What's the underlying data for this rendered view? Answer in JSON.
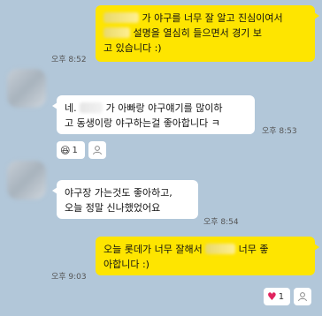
{
  "messages": [
    {
      "direction": "out",
      "lines": [
        [
          "",
          "가 야구를 너무 잘 알고 진심이여서"
        ],
        [
          "",
          "설명을 열심히 들으면서 경기 보"
        ],
        [
          "고 있습니다 :)"
        ]
      ],
      "time": "오후 8:52"
    },
    {
      "direction": "in",
      "lines": [
        [
          "네. ",
          "가 아빠랑 야구얘기를 많이하"
        ],
        [
          "고 동생이랑 야구하는걸 좋아합니다 ㅋ"
        ]
      ],
      "time": "오후 8:53",
      "reaction": {
        "emoji_icon": "laughing-face-icon",
        "emoji": "😆",
        "count": "1"
      }
    },
    {
      "direction": "in",
      "lines": [
        [
          "야구장 가는것도 좋아하고,"
        ],
        [
          "오늘 정말 신나했었어요"
        ]
      ],
      "time": "오후 8:54"
    },
    {
      "direction": "out",
      "lines": [
        [
          "오늘 롯데가 너무 잘해서 ",
          "",
          " 너무 좋"
        ],
        [
          "아합니다 :)"
        ]
      ],
      "time": "오후 9:03",
      "reaction": {
        "emoji_icon": "heart-icon",
        "emoji": "♥",
        "count": "1"
      }
    }
  ],
  "colors": {
    "background": "#b2c7d9",
    "outgoing_bubble": "#fee500",
    "incoming_bubble": "#ffffff",
    "heart": "#e0245e"
  }
}
